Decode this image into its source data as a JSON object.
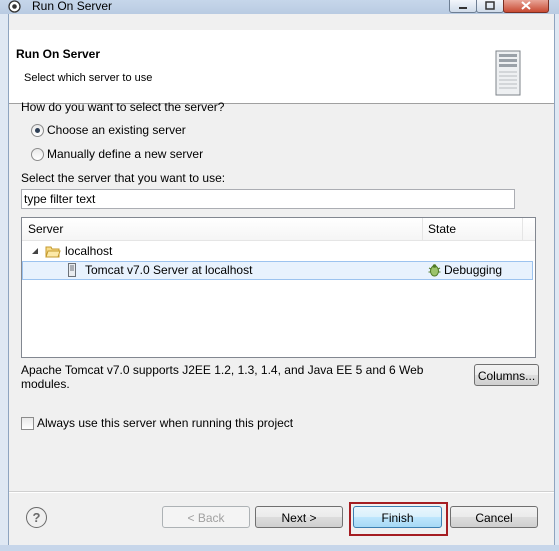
{
  "window": {
    "title": "Run On Server"
  },
  "banner": {
    "title": "Run On Server",
    "subtitle": "Select which server to use"
  },
  "selection": {
    "question": "How do you want to select the server?",
    "options": [
      {
        "label": "Choose an existing server",
        "selected": true
      },
      {
        "label": "Manually define a new server",
        "selected": false
      }
    ]
  },
  "filter": {
    "label": "Select the server that you want to use:",
    "value": "type filter text"
  },
  "table": {
    "columns": [
      "Server",
      "State"
    ],
    "rows": [
      {
        "name": "localhost",
        "state": "",
        "type": "folder",
        "expanded": true
      },
      {
        "name": "Tomcat v7.0 Server at localhost",
        "state": "Debugging",
        "type": "server",
        "selected": true
      }
    ]
  },
  "description": "Apache Tomcat v7.0 supports J2EE 1.2, 1.3, 1.4, and Java EE 5 and 6 Web modules.",
  "buttons": {
    "columns": "Columns...",
    "back": "< Back",
    "next": "Next >",
    "finish": "Finish",
    "cancel": "Cancel",
    "help": "?"
  },
  "always_use": {
    "label": "Always use this server when running this project",
    "checked": false
  },
  "colors": {
    "highlight": "#a51d22",
    "selection": "#e8f2fd"
  }
}
